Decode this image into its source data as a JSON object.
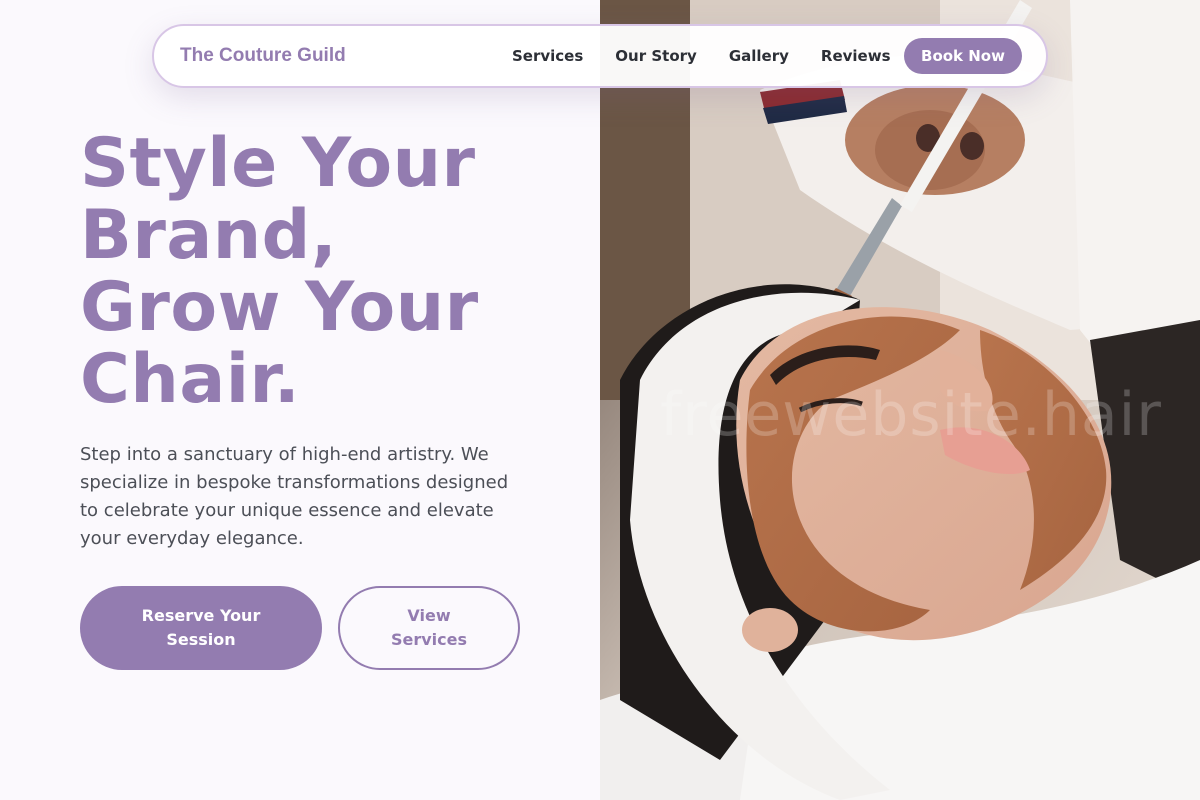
{
  "nav": {
    "brand": "The Couture Guild",
    "links": [
      "Services",
      "Our Story",
      "Gallery",
      "Reviews"
    ],
    "cta": "Book Now"
  },
  "hero": {
    "headline_lines": [
      "Style Your",
      "Brand,",
      "Grow Your",
      "Chair."
    ],
    "description": "Step into a sanctuary of high-end artistry. We specialize in bespoke transformations designed to celebrate your unique essence and elevate your everyday elegance.",
    "primary_button": "Reserve Your Session",
    "secondary_button": "View Services"
  },
  "image": {
    "watermark": "freewebsite.hair"
  },
  "colors": {
    "accent": "#937cb0",
    "background": "#fbf9fd",
    "text": "#4c4f57"
  }
}
